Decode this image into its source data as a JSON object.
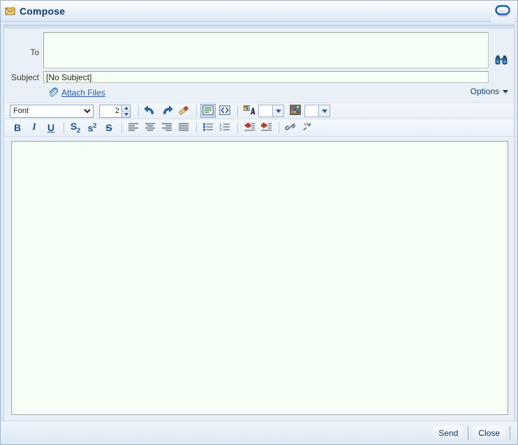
{
  "window": {
    "title": "Compose",
    "title_icon": "compose-mail-icon",
    "corner_icon": "chat-bubble-icon"
  },
  "fields": {
    "to_label": "To",
    "to_value": "",
    "to_placeholder": "",
    "addressbook_icon": "binoculars-icon",
    "subject_label": "Subject",
    "subject_value": "[No Subject]",
    "subject_placeholder": ""
  },
  "actions": {
    "attach_label": "Attach Files",
    "attach_icon": "paperclip-icon",
    "options_label": "Options",
    "options_icon": "caret-down-icon"
  },
  "toolbar_row1": {
    "font_selected": "Font",
    "font_options": [
      "Font"
    ],
    "size_value": "2",
    "buttons": [
      {
        "name": "undo-button",
        "icon": "undo-arrow-icon",
        "label": "Undo"
      },
      {
        "name": "redo-button",
        "icon": "redo-arrow-icon",
        "label": "Redo"
      },
      {
        "name": "remove-formatting-button",
        "icon": "eraser-icon",
        "label": "Remove Formatting"
      },
      {
        "name": "wysiwyg-view-button",
        "icon": "document-text-icon",
        "label": "Rich Text View"
      },
      {
        "name": "source-view-button",
        "icon": "angle-brackets-icon",
        "label": "Source"
      },
      {
        "name": "text-color-button",
        "icon": "color-letter-a-icon",
        "label": "Text Color"
      },
      {
        "name": "text-color-swatch",
        "icon": "color-swatch-icon",
        "label": ""
      },
      {
        "name": "text-color-dropdown",
        "icon": "caret-down-icon",
        "label": ""
      },
      {
        "name": "background-color-button",
        "icon": "color-grid-icon",
        "label": "Background Color"
      },
      {
        "name": "background-color-swatch",
        "icon": "color-swatch-icon",
        "label": ""
      },
      {
        "name": "background-color-dropdown",
        "icon": "caret-down-icon",
        "label": ""
      }
    ]
  },
  "toolbar_row2": {
    "buttons": [
      {
        "name": "bold-button",
        "icon": "bold-icon",
        "label": "B"
      },
      {
        "name": "italic-button",
        "icon": "italic-icon",
        "label": "I"
      },
      {
        "name": "underline-button",
        "icon": "underline-icon",
        "label": "U"
      },
      {
        "name": "subscript-button",
        "icon": "subscript-icon",
        "label": "S2"
      },
      {
        "name": "superscript-button",
        "icon": "superscript-icon",
        "label": "s2"
      },
      {
        "name": "strikethrough-button",
        "icon": "strikethrough-icon",
        "label": "S"
      },
      {
        "name": "align-left-button",
        "icon": "align-left-icon",
        "label": "Align Left"
      },
      {
        "name": "align-center-button",
        "icon": "align-center-icon",
        "label": "Align Center"
      },
      {
        "name": "align-right-button",
        "icon": "align-right-icon",
        "label": "Align Right"
      },
      {
        "name": "align-justify-button",
        "icon": "align-justify-icon",
        "label": "Justify"
      },
      {
        "name": "bullet-list-button",
        "icon": "bullet-list-icon",
        "label": "Bulleted List"
      },
      {
        "name": "numbered-list-button",
        "icon": "numbered-list-icon",
        "label": "Numbered List"
      },
      {
        "name": "outdent-button",
        "icon": "outdent-arrow-icon",
        "label": "Outdent"
      },
      {
        "name": "indent-button",
        "icon": "indent-arrow-icon",
        "label": "Indent"
      },
      {
        "name": "insert-link-button",
        "icon": "chain-link-icon",
        "label": "Insert Link"
      },
      {
        "name": "remove-link-button",
        "icon": "broken-chain-icon",
        "label": "Remove Link"
      }
    ]
  },
  "editor": {
    "body_value": "",
    "body_placeholder": ""
  },
  "footer": {
    "send_label": "Send",
    "close_label": "Close"
  },
  "colors": {
    "title_text": "#123a6b",
    "link": "#1b5ea8",
    "field_bg": "#f5fff5",
    "panel_bg": "#eaf0f7",
    "window_bg": "#dfe9f3",
    "toolbar_icon_blue": "#1a4f97",
    "indent_red": "#cc2b1d"
  }
}
